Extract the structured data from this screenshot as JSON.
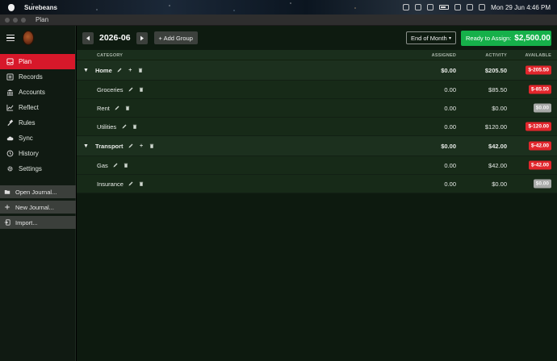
{
  "menubar": {
    "app_name": "Surebeans",
    "datetime": "Mon 29 Jun  4:46 PM"
  },
  "window": {
    "title": "Plan"
  },
  "sidebar": {
    "items": [
      {
        "label": "Plan",
        "icon": "inbox-icon",
        "active": true
      },
      {
        "label": "Records",
        "icon": "list-icon"
      },
      {
        "label": "Accounts",
        "icon": "bank-icon"
      },
      {
        "label": "Reflect",
        "icon": "chart-icon"
      },
      {
        "label": "Rules",
        "icon": "gavel-icon"
      },
      {
        "label": "Sync",
        "icon": "cloud-icon"
      },
      {
        "label": "History",
        "icon": "history-icon"
      },
      {
        "label": "Settings",
        "icon": "gear-icon"
      }
    ],
    "actions": [
      {
        "label": "Open Journal...",
        "icon": "folder-icon"
      },
      {
        "label": "New Journal...",
        "icon": "plus-icon"
      },
      {
        "label": "Import...",
        "icon": "import-icon"
      }
    ]
  },
  "toolbar": {
    "month": "2026-06",
    "add_group": "+ Add Group",
    "period": "End of Month",
    "ready_label": "Ready to Assign:",
    "ready_amount": "$2,500.00"
  },
  "table": {
    "headers": {
      "category": "CATEGORY",
      "assigned": "ASSIGNED",
      "activity": "ACTIVITY",
      "available": "AVAILABLE"
    },
    "rows": [
      {
        "type": "group",
        "name": "Home",
        "assigned": "$0.00",
        "activity": "$205.50",
        "available": "$-205.50",
        "status": "negative"
      },
      {
        "type": "category",
        "name": "Groceries",
        "assigned": "0.00",
        "activity": "$85.50",
        "available": "$-85.50",
        "status": "negative"
      },
      {
        "type": "category",
        "name": "Rent",
        "assigned": "0.00",
        "activity": "$0.00",
        "available": "$0.00",
        "status": "zero"
      },
      {
        "type": "category",
        "name": "Utilities",
        "assigned": "0.00",
        "activity": "$120.00",
        "available": "$-120.00",
        "status": "negative"
      },
      {
        "type": "group",
        "name": "Transport",
        "assigned": "$0.00",
        "activity": "$42.00",
        "available": "$-42.00",
        "status": "negative"
      },
      {
        "type": "category",
        "name": "Gas",
        "assigned": "0.00",
        "activity": "$42.00",
        "available": "$-42.00",
        "status": "negative"
      },
      {
        "type": "category",
        "name": "Insurance",
        "assigned": "0.00",
        "activity": "$0.00",
        "available": "$0.00",
        "status": "zero"
      }
    ]
  },
  "colors": {
    "accent_red": "#d7182a",
    "ready_green": "#16b04a",
    "negative": "#e2262c",
    "zero": "#a8aaa8"
  }
}
